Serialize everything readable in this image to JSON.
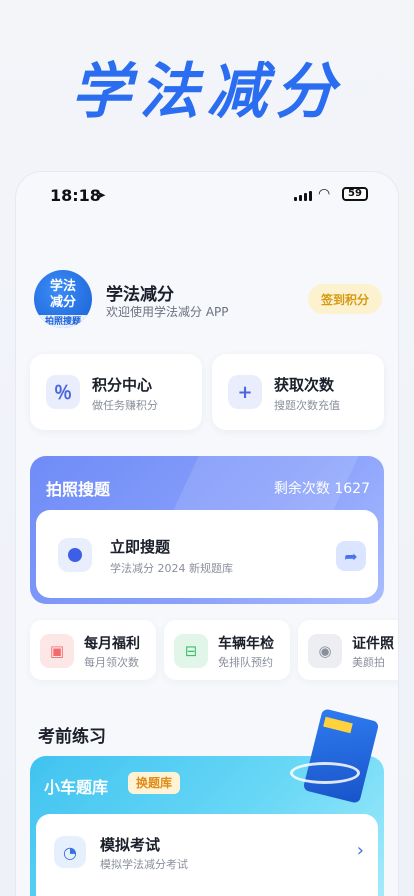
{
  "hero": {
    "title": "学法减分"
  },
  "status_bar": {
    "time": "18:18",
    "battery": "59",
    "location_icon": "location-arrow-icon",
    "signal_icon": "signal-icon",
    "wifi_icon": "wifi-icon"
  },
  "profile": {
    "logo_text_line1": "学法",
    "logo_text_line2": "减分",
    "logo_sub": "拍照搜题",
    "app_name": "学法减分",
    "welcome": "欢迎使用学法减分 APP",
    "checkin": "签到积分"
  },
  "quick_actions": [
    {
      "icon": "percent-icon",
      "glyph": "％",
      "title": "积分中心",
      "subtitle": "做任务赚积分"
    },
    {
      "icon": "plus-icon",
      "glyph": "+",
      "title": "获取次数",
      "subtitle": "搜题次数充值"
    }
  ],
  "photo_search": {
    "title": "拍照搜题",
    "remaining": "剩余次数 1627",
    "action_title": "立即搜题",
    "action_subtitle": "学法减分 2024 新规题库",
    "action_icon": "camera-icon"
  },
  "benefits": [
    {
      "icon": "gift-icon",
      "glyph": "▣",
      "title": "每月福利",
      "subtitle": "每月领次数",
      "color": "#f26a6a",
      "bg": "#fde6e6"
    },
    {
      "icon": "car-icon",
      "glyph": "⊟",
      "title": "车辆年检",
      "subtitle": "免排队预约",
      "color": "#3fbf6a",
      "bg": "#e1f6e8"
    },
    {
      "icon": "camera-icon",
      "glyph": "◉",
      "title": "证件照",
      "subtitle": "美颜拍",
      "color": "#8a8f9c",
      "bg": "#eceef2"
    }
  ],
  "practice": {
    "title": "考前练习",
    "card_title": "小车题库",
    "switch_label": "换题库",
    "exam_title": "模拟考试",
    "exam_subtitle": "模拟学法减分考试"
  },
  "colors": {
    "accent": "#2a6df0",
    "search_card": "#7a96f8",
    "car_card": "#4fcaf2",
    "checkin": "#d69a12"
  }
}
